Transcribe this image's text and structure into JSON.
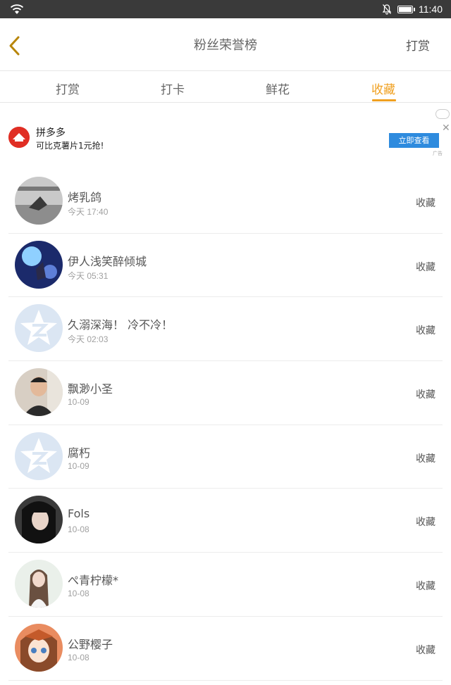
{
  "status_bar": {
    "time": "11:40"
  },
  "header": {
    "title": "粉丝荣誉榜",
    "action_label": "打赏"
  },
  "tabs": [
    {
      "label": "打赏"
    },
    {
      "label": "打卡"
    },
    {
      "label": "鲜花"
    },
    {
      "label": "收藏"
    }
  ],
  "active_tab": "收藏",
  "ad": {
    "brand": "拼多多",
    "description": "可比克薯片1元抢!",
    "button_label": "立即查看",
    "tag": "广告"
  },
  "list": [
    {
      "name": "烤乳鸽",
      "time": "今天 17:40",
      "action": "收藏",
      "avatar": "photo-bird"
    },
    {
      "name": "伊人浅笑醉倾城",
      "time": "今天 05:31",
      "action": "收藏",
      "avatar": "photo-anime-night"
    },
    {
      "name": "久溺深海！ 冷不冷！",
      "time": "今天 02:03",
      "action": "收藏",
      "avatar": "default-qq"
    },
    {
      "name": "飘渺小圣",
      "time": "10-09",
      "action": "收藏",
      "avatar": "photo-man"
    },
    {
      "name": "腐朽",
      "time": "10-09",
      "action": "收藏",
      "avatar": "default-qq"
    },
    {
      "name": "Fols",
      "time": "10-08",
      "action": "收藏",
      "avatar": "photo-woman"
    },
    {
      "name": "ぺ青柠檬*",
      "time": "10-08",
      "action": "收藏",
      "avatar": "photo-girl"
    },
    {
      "name": "公野樱子",
      "time": "10-08",
      "action": "收藏",
      "avatar": "photo-anime-girl"
    }
  ],
  "colors": {
    "accent": "#f0a020",
    "ad_button": "#2e8bde",
    "status_bar": "#3a3a3a"
  }
}
